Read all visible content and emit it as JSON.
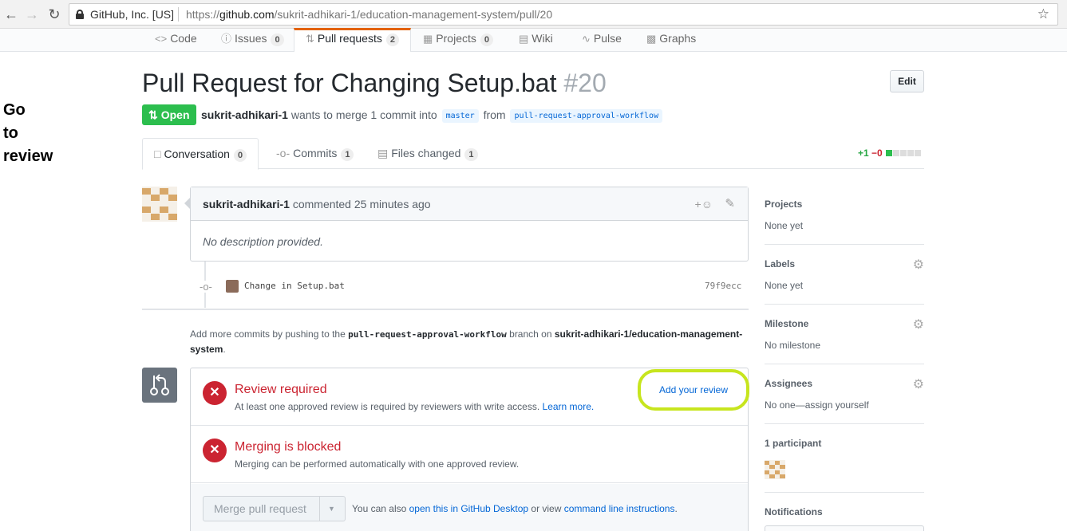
{
  "browser": {
    "org": "GitHub, Inc. [US]",
    "url_prefix": "https://",
    "url_domain": "github.com",
    "url_path": "/sukrit-adhikari-1/education-management-system/pull/20"
  },
  "repo_nav": [
    {
      "label": "Code",
      "icon": "code-icon",
      "count": ""
    },
    {
      "label": "Issues",
      "icon": "issue-icon",
      "count": "0"
    },
    {
      "label": "Pull requests",
      "icon": "pull-request-icon",
      "count": "2"
    },
    {
      "label": "Projects",
      "icon": "project-icon",
      "count": "0"
    },
    {
      "label": "Wiki",
      "icon": "wiki-icon",
      "count": ""
    },
    {
      "label": "Pulse",
      "icon": "pulse-icon",
      "count": ""
    },
    {
      "label": "Graphs",
      "icon": "graph-icon",
      "count": ""
    }
  ],
  "annotation": {
    "line1": "Go",
    "line2": "to",
    "line3": "review"
  },
  "pr": {
    "title": "Pull Request for Changing Setup.bat",
    "number": "#20",
    "edit_label": "Edit",
    "state": "Open",
    "author": "sukrit-adhikari-1",
    "merge_text": "wants to merge 1 commit into",
    "base_branch": "master",
    "from_text": "from",
    "head_branch": "pull-request-approval-workflow"
  },
  "pr_tabs": [
    {
      "label": "Conversation",
      "count": "0"
    },
    {
      "label": "Commits",
      "count": "1"
    },
    {
      "label": "Files changed",
      "count": "1"
    }
  ],
  "diffstat": {
    "additions": "+1",
    "deletions": "−0"
  },
  "comment": {
    "author": "sukrit-adhikari-1",
    "action": "commented 25 minutes ago",
    "body": "No description provided."
  },
  "commit": {
    "message": "Change in Setup.bat",
    "sha": "79f9ecc"
  },
  "push_hint": {
    "prefix": "Add more commits by pushing to the",
    "branch": "pull-request-approval-workflow",
    "middle": "branch on",
    "repo": "sukrit-adhikari-1/education-management-system",
    "suffix": "."
  },
  "merge_box": {
    "review_title": "Review required",
    "review_desc": "At least one approved review is required by reviewers with write access.",
    "learn_more": "Learn more.",
    "add_review": "Add your review",
    "blocked_title": "Merging is blocked",
    "blocked_desc": "Merging can be performed automatically with one approved review.",
    "merge_button": "Merge pull request",
    "alt_prefix": "You can also",
    "alt_desktop": "open this in GitHub Desktop",
    "alt_middle": "or view",
    "alt_cli": "command line instructions",
    "alt_suffix": "."
  },
  "sidebar": {
    "projects_label": "Projects",
    "projects_value": "None yet",
    "labels_label": "Labels",
    "labels_value": "None yet",
    "milestone_label": "Milestone",
    "milestone_value": "No milestone",
    "assignees_label": "Assignees",
    "assignees_value": "No one—assign yourself",
    "participants_label": "1 participant",
    "notifications_label": "Notifications"
  },
  "colors": {
    "accent_orange": "#e36209",
    "open_green": "#2cbe4e",
    "error_red": "#cb2431",
    "highlight_yellow": "#c7e51e",
    "link_blue": "#0366d6"
  }
}
